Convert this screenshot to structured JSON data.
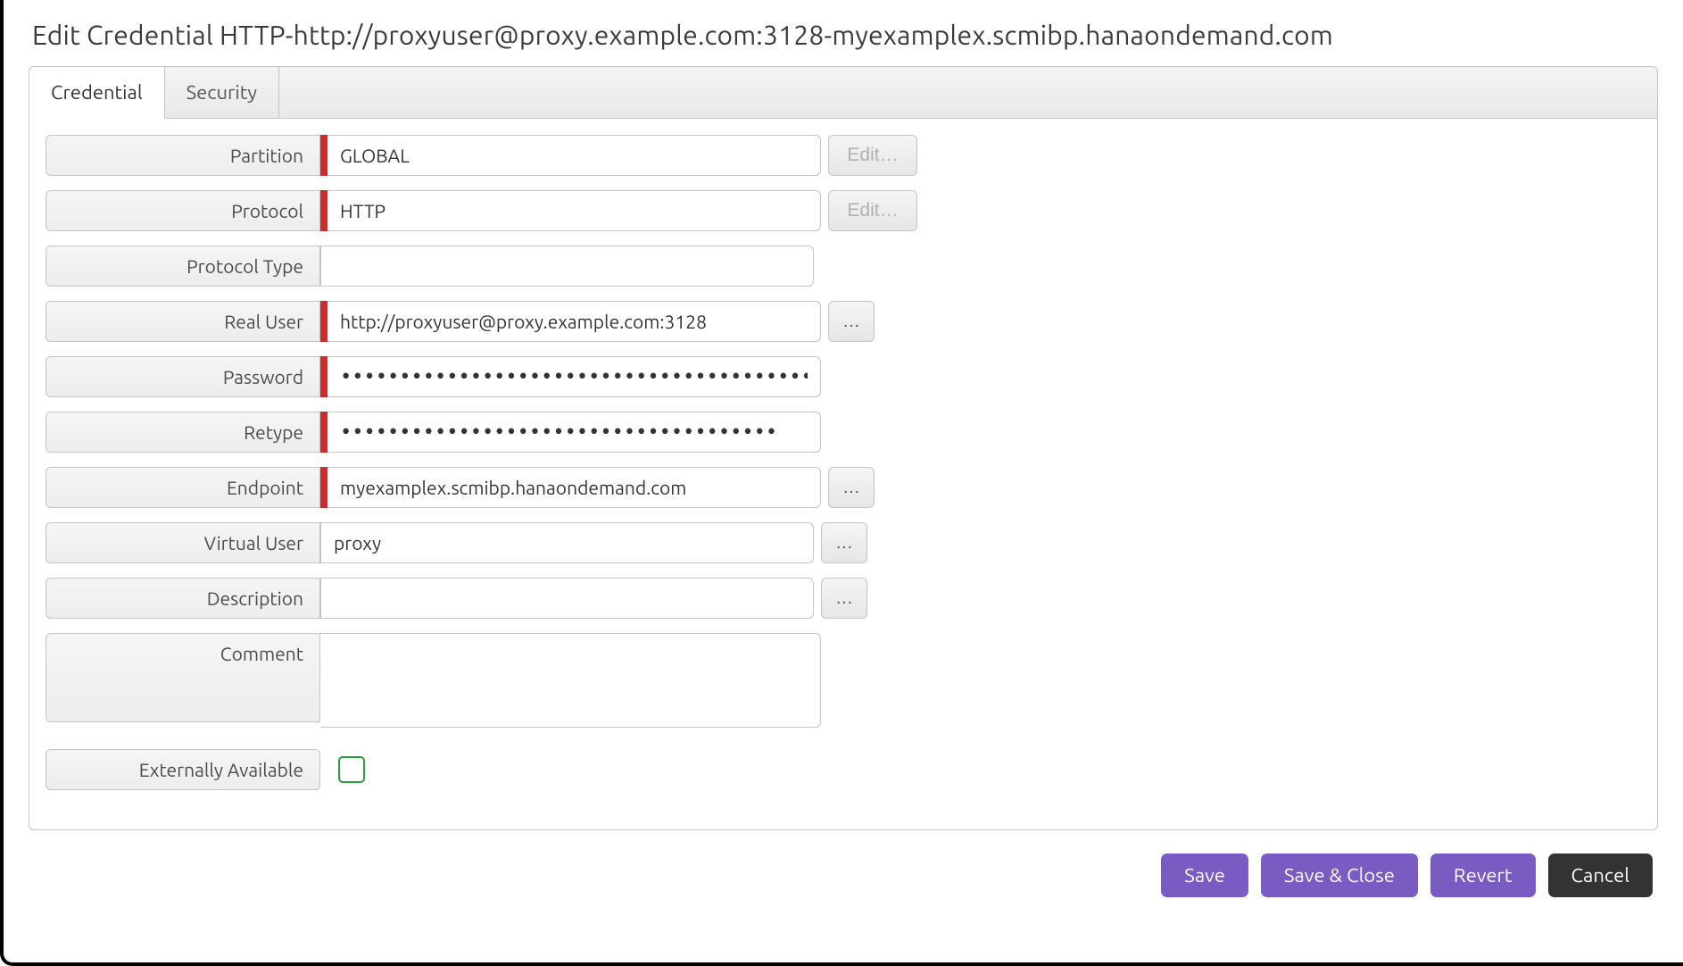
{
  "title": "Edit Credential HTTP-http://proxyuser@proxy.example.com:3128-myexamplex.scmibp.hanaondemand.com",
  "tabs": {
    "credential": "Credential",
    "security": "Security"
  },
  "form": {
    "labels": {
      "partition": "Partition",
      "protocol": "Protocol",
      "protocol_type": "Protocol Type",
      "real_user": "Real User",
      "password": "Password",
      "retype": "Retype",
      "endpoint": "Endpoint",
      "virtual_user": "Virtual User",
      "description": "Description",
      "comment": "Comment",
      "externally_available": "Externally Available"
    },
    "values": {
      "partition": "GLOBAL",
      "protocol": "HTTP",
      "protocol_type": "",
      "real_user": "http://proxyuser@proxy.example.com:3128",
      "password": "••••••••••••••••••••••••••••••••••••••••",
      "retype": "•••••••••••••••••••••••••••••••••••••",
      "endpoint": "myexamplex.scmibp.hanaondemand.com",
      "virtual_user": "proxy",
      "description": "",
      "comment": ""
    },
    "aux": {
      "edit": "Edit…",
      "browse": "…"
    },
    "externally_available_checked": false
  },
  "buttons": {
    "save": "Save",
    "save_close": "Save & Close",
    "revert": "Revert",
    "cancel": "Cancel"
  }
}
